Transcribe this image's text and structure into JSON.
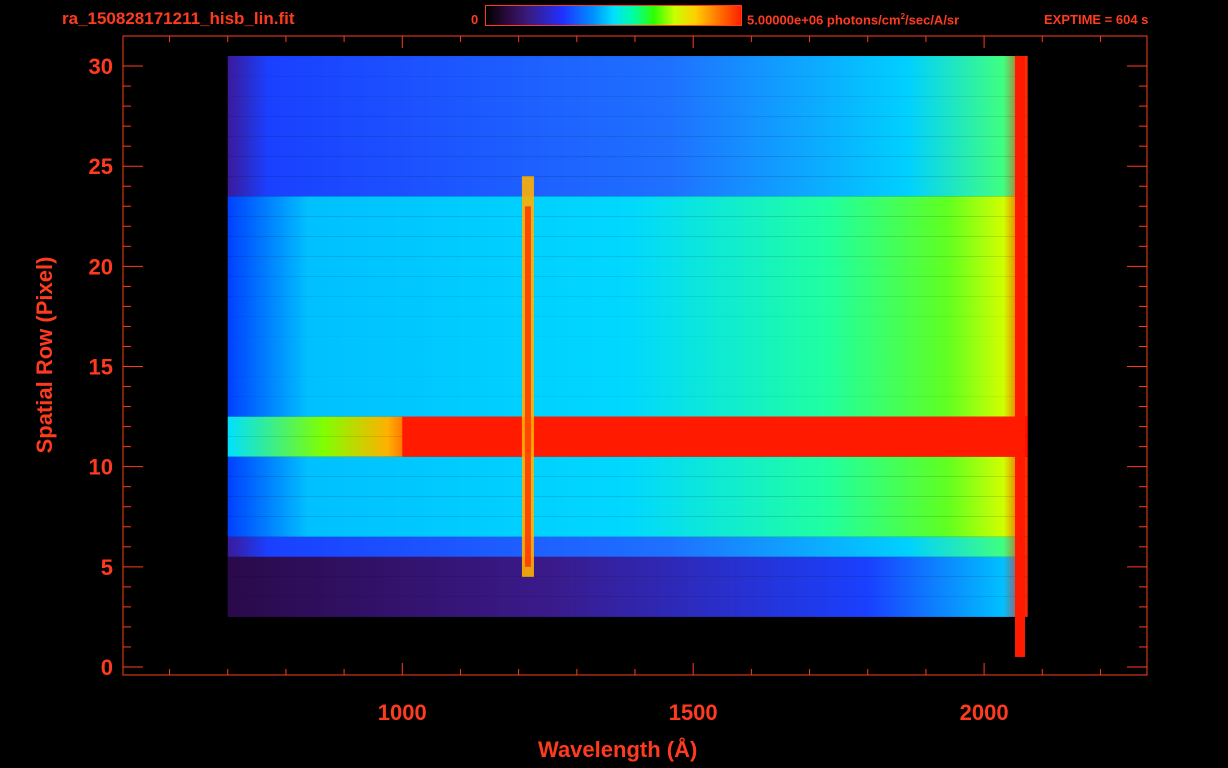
{
  "header": {
    "title": "ra_150828171211_hisb_lin.fit",
    "colorbar_min": "0",
    "colorbar_max_prefix": "5.00000e+06 photons/cm",
    "colorbar_max_sup": "2",
    "colorbar_max_suffix": "/sec/A/sr",
    "exptime": "EXPTIME = 604 s"
  },
  "chart_data": {
    "type": "heatmap",
    "title": "ra_150828171211_hisb_lin.fit",
    "xlabel": "Wavelength (Å)",
    "ylabel": "Spatial Row (Pixel)",
    "xlim": [
      520,
      2280
    ],
    "ylim": [
      -0.4,
      31.5
    ],
    "x_ticks": [
      1000,
      1500,
      2000
    ],
    "y_ticks": [
      0,
      5,
      10,
      15,
      20,
      25,
      30
    ],
    "colorbar": {
      "min": 0,
      "max": 5000000,
      "units": "photons/cm^2/sec/A/sr"
    },
    "data_extent": {
      "x": [
        700,
        2075
      ],
      "y": [
        0,
        30
      ]
    },
    "features": [
      {
        "type": "bright_row_band",
        "rows": [
          11,
          12
        ],
        "x_range": [
          1000,
          2065
        ],
        "level": "max"
      },
      {
        "type": "emission_line",
        "x": 1216,
        "rows": [
          5,
          24
        ],
        "level": "high"
      },
      {
        "type": "edge_cutoff",
        "x": 2060,
        "rows": [
          1,
          30
        ],
        "level": "max"
      }
    ],
    "colors": {
      "axis": "#ff3b1f",
      "background": "#000000"
    }
  }
}
